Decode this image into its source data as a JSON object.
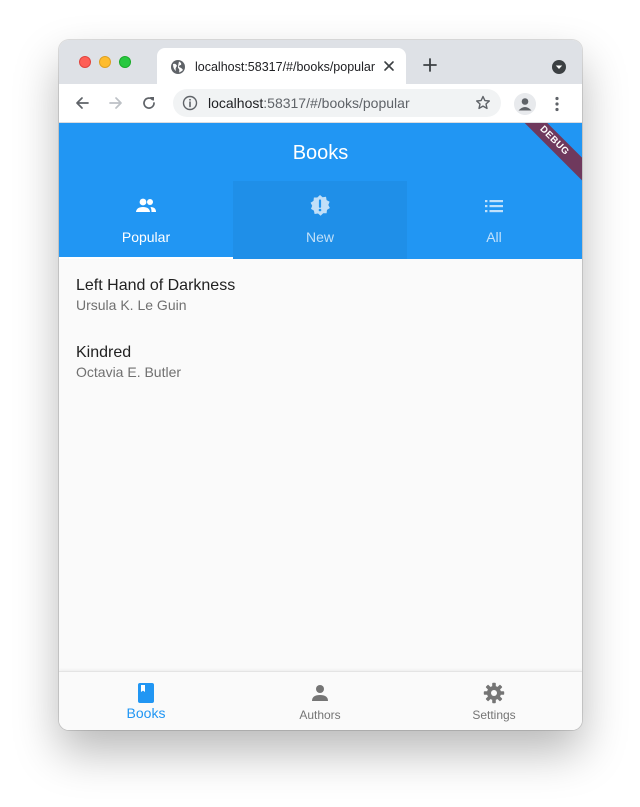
{
  "browser": {
    "tab_title": "localhost:58317/#/books/popular",
    "url_host": "localhost",
    "url_rest": ":58317/#/books/popular",
    "icons": {
      "tab_favicon": "globe-icon",
      "tab_close": "close-icon",
      "new_tab": "plus-icon",
      "tab_search": "chevron-down-icon",
      "back": "arrow-left-icon",
      "forward": "arrow-right-icon",
      "reload": "reload-icon",
      "site_info": "info-icon",
      "bookmark": "star-icon",
      "profile": "person-icon",
      "menu": "more-vert-icon"
    }
  },
  "app": {
    "title": "Books",
    "debug_banner": "DEBUG",
    "colors": {
      "primary": "#2196f3",
      "on_primary": "#ffffff",
      "inactive": "#757575"
    },
    "tabs": [
      {
        "label": "Popular",
        "icon": "people-icon",
        "selected": true
      },
      {
        "label": "New",
        "icon": "new-releases-icon",
        "selected": false
      },
      {
        "label": "All",
        "icon": "list-icon",
        "selected": false
      }
    ],
    "books": [
      {
        "title": "Left Hand of Darkness",
        "author": "Ursula K. Le Guin"
      },
      {
        "title": "Kindred",
        "author": "Octavia E. Butler"
      }
    ],
    "bottom_nav": [
      {
        "label": "Books",
        "icon": "book-icon",
        "active": true
      },
      {
        "label": "Authors",
        "icon": "person-icon",
        "active": false
      },
      {
        "label": "Settings",
        "icon": "gear-icon",
        "active": false
      }
    ]
  }
}
